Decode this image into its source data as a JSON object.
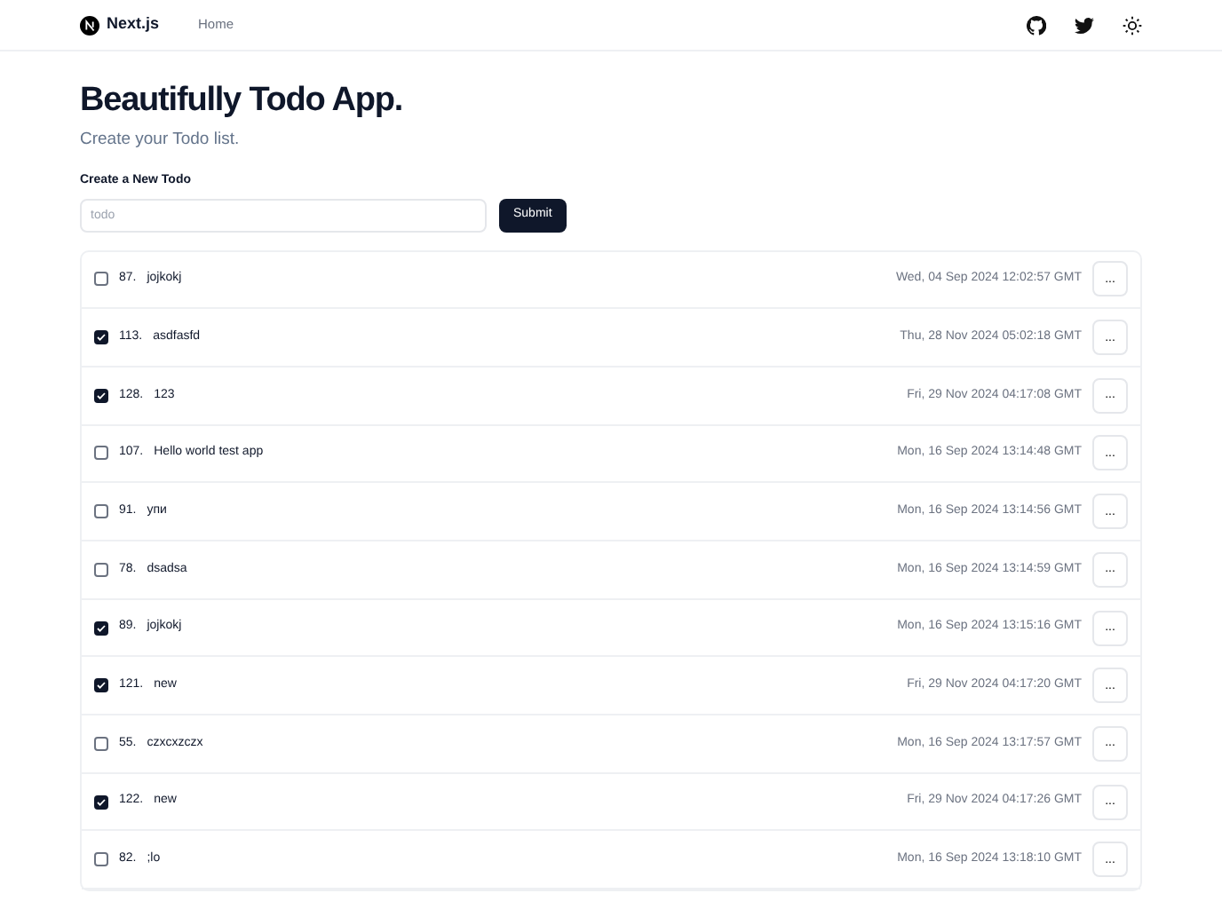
{
  "navbar": {
    "brand": "Next.js",
    "links": [
      {
        "label": "Home"
      }
    ]
  },
  "header": {
    "title": "Beautifully Todo App.",
    "subtitle": "Create your Todo list."
  },
  "form": {
    "label": "Create a New Todo",
    "placeholder": "todo",
    "button": "Submit"
  },
  "todos": [
    {
      "number": "87.",
      "text": "jojkokj",
      "checked": false,
      "date": "Wed, 04 Sep 2024 12:02:57 GMT",
      "menu": "..."
    },
    {
      "number": "113.",
      "text": "asdfasfd",
      "checked": true,
      "date": "Thu, 28 Nov 2024 05:02:18 GMT",
      "menu": "..."
    },
    {
      "number": "128.",
      "text": "123",
      "checked": true,
      "date": "Fri, 29 Nov 2024 04:17:08 GMT",
      "menu": "..."
    },
    {
      "number": "107.",
      "text": "Hello world test app",
      "checked": false,
      "date": "Mon, 16 Sep 2024 13:14:48 GMT",
      "menu": "..."
    },
    {
      "number": "91.",
      "text": "упи",
      "checked": false,
      "date": "Mon, 16 Sep 2024 13:14:56 GMT",
      "menu": "..."
    },
    {
      "number": "78.",
      "text": "dsadsa",
      "checked": false,
      "date": "Mon, 16 Sep 2024 13:14:59 GMT",
      "menu": "..."
    },
    {
      "number": "89.",
      "text": "jojkokj",
      "checked": true,
      "date": "Mon, 16 Sep 2024 13:15:16 GMT",
      "menu": "..."
    },
    {
      "number": "121.",
      "text": "new",
      "checked": true,
      "date": "Fri, 29 Nov 2024 04:17:20 GMT",
      "menu": "..."
    },
    {
      "number": "55.",
      "text": "czxcxzczx",
      "checked": false,
      "date": "Mon, 16 Sep 2024 13:17:57 GMT",
      "menu": "..."
    },
    {
      "number": "122.",
      "text": "new",
      "checked": true,
      "date": "Fri, 29 Nov 2024 04:17:26 GMT",
      "menu": "..."
    },
    {
      "number": "82.",
      "text": ";lo",
      "checked": false,
      "date": "Mon, 16 Sep 2024 13:18:10 GMT",
      "menu": "..."
    }
  ]
}
